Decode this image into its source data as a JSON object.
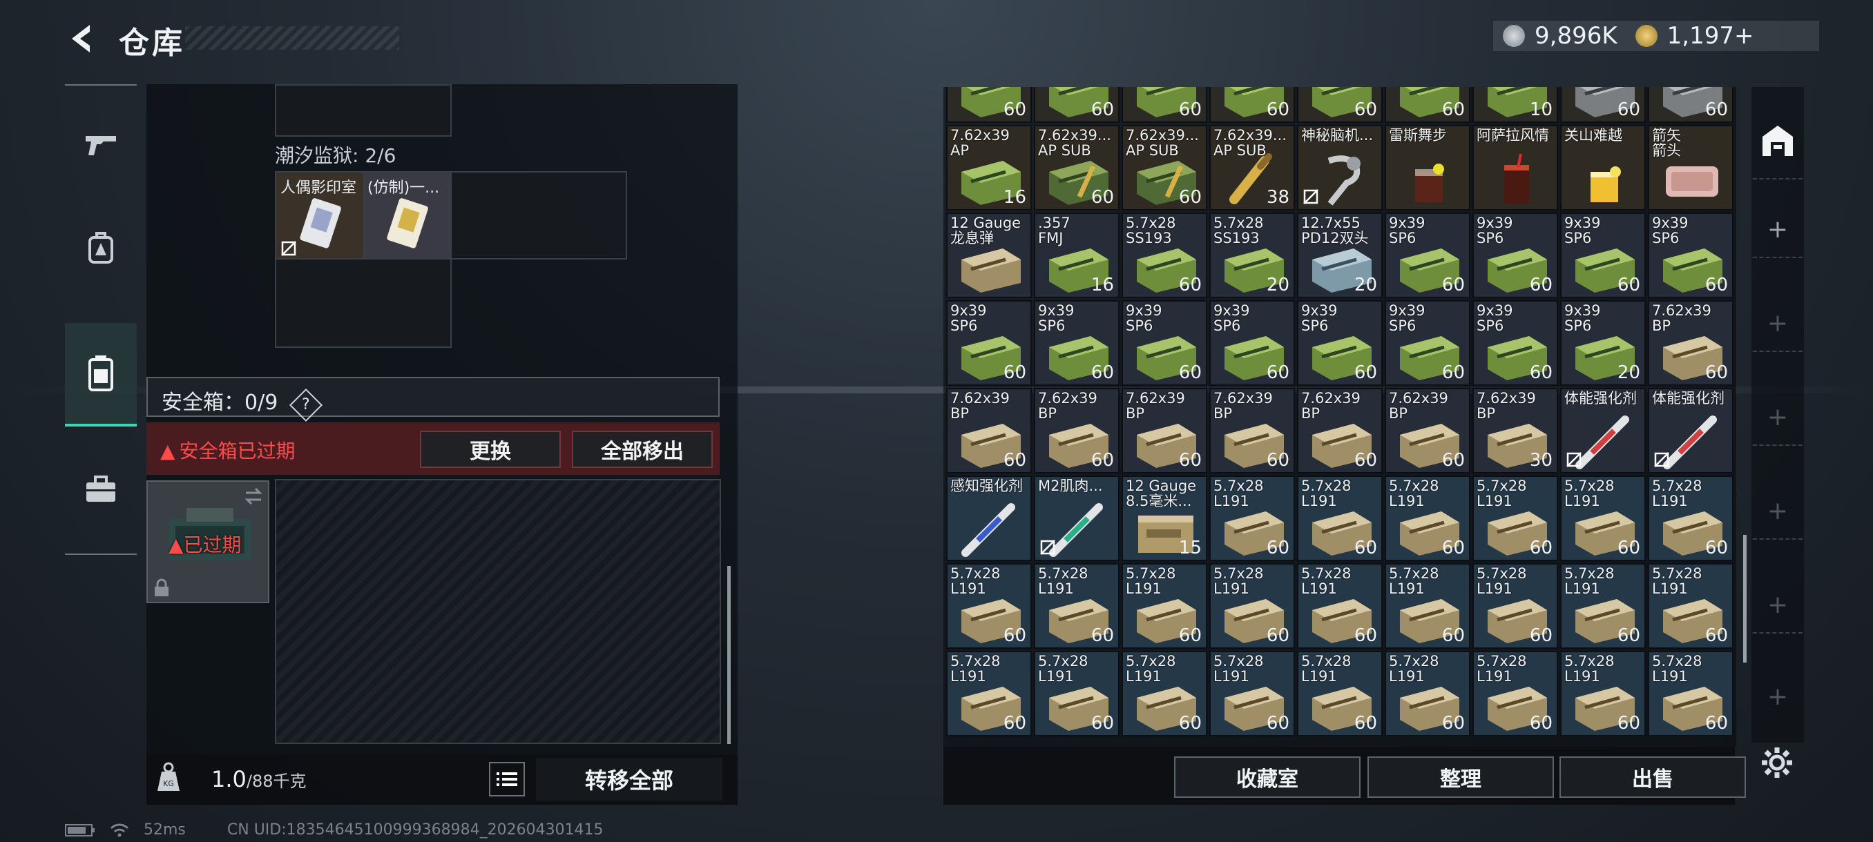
{
  "header": {
    "title": "仓库",
    "currency": [
      {
        "icon": "silver-coin-icon",
        "value": "9,896K"
      },
      {
        "icon": "gold-coin-icon",
        "value": "1,197+"
      }
    ]
  },
  "nav": [
    {
      "icon": "gun-icon"
    },
    {
      "icon": "backpack-icon"
    },
    {
      "icon": "safe-container-icon",
      "active": true
    },
    {
      "icon": "toolbox-icon"
    }
  ],
  "stash": {
    "prison_label": "潮汐监狱: 2/6",
    "prison_items": [
      "人偶影印室",
      "(仿制)一..."
    ],
    "safebox_label": "安全箱：0/9",
    "safebox_help": "?",
    "expired_warning": "安全箱已过期",
    "replace_button": "更换",
    "remove_all_button": "全部移出",
    "slot_expired": "已过期",
    "weight_value": "1.0",
    "weight_unit": "/88千克",
    "transfer_all_button": "转移全部"
  },
  "grid_rows": [
    [
      {
        "n": "",
        "c": "60",
        "k": "green"
      },
      {
        "n": "",
        "c": "60",
        "k": "green"
      },
      {
        "n": "",
        "c": "60",
        "k": "green"
      },
      {
        "n": "",
        "c": "60",
        "k": "green"
      },
      {
        "n": "",
        "c": "60",
        "k": "green"
      },
      {
        "n": "",
        "c": "60",
        "k": "green"
      },
      {
        "n": "",
        "c": "10",
        "k": "green"
      },
      {
        "n": "",
        "c": "60",
        "k": "gray"
      },
      {
        "n": "",
        "c": "60",
        "k": "gray"
      }
    ],
    [
      {
        "n": "7.62x39\nAP",
        "c": "16",
        "k": "green"
      },
      {
        "n": "7.62x39...\nAP SUB",
        "c": "60",
        "k": "greenb"
      },
      {
        "n": "7.62x39...\nAP SUB",
        "c": "60",
        "k": "greenb"
      },
      {
        "n": "7.62x39...\nAP SUB",
        "c": "38",
        "k": "bullet"
      },
      {
        "n": "神秘脑机...",
        "c": "",
        "k": "brain",
        "ns": true
      },
      {
        "n": "雷斯舞步",
        "c": "",
        "k": "drink1"
      },
      {
        "n": "阿萨拉风情",
        "c": "",
        "k": "drink2"
      },
      {
        "n": "关山难越",
        "c": "",
        "k": "drink3"
      },
      {
        "n": "箭矢\n箭头",
        "c": "",
        "k": "pink"
      }
    ],
    [
      {
        "n": "12 Gauge\n龙息弹",
        "c": "",
        "k": "tan"
      },
      {
        "n": ".357\nFMJ",
        "c": "16",
        "k": "green"
      },
      {
        "n": "5.7x28\nSS193",
        "c": "60",
        "k": "green"
      },
      {
        "n": "5.7x28\nSS193",
        "c": "20",
        "k": "green"
      },
      {
        "n": "12.7x55\nPD12双头",
        "c": "20",
        "k": "blue"
      },
      {
        "n": "9x39\nSP6",
        "c": "60",
        "k": "green"
      },
      {
        "n": "9x39\nSP6",
        "c": "60",
        "k": "green"
      },
      {
        "n": "9x39\nSP6",
        "c": "60",
        "k": "green"
      },
      {
        "n": "9x39\nSP6",
        "c": "60",
        "k": "green"
      }
    ],
    [
      {
        "n": "9x39\nSP6",
        "c": "60",
        "k": "green"
      },
      {
        "n": "9x39\nSP6",
        "c": "60",
        "k": "green"
      },
      {
        "n": "9x39\nSP6",
        "c": "60",
        "k": "green"
      },
      {
        "n": "9x39\nSP6",
        "c": "60",
        "k": "green"
      },
      {
        "n": "9x39\nSP6",
        "c": "60",
        "k": "green"
      },
      {
        "n": "9x39\nSP6",
        "c": "60",
        "k": "green"
      },
      {
        "n": "9x39\nSP6",
        "c": "60",
        "k": "green"
      },
      {
        "n": "9x39\nSP6",
        "c": "20",
        "k": "green"
      },
      {
        "n": "7.62x39\nBP",
        "c": "60",
        "k": "tan"
      }
    ],
    [
      {
        "n": "7.62x39\nBP",
        "c": "60",
        "k": "tan"
      },
      {
        "n": "7.62x39\nBP",
        "c": "60",
        "k": "tan"
      },
      {
        "n": "7.62x39\nBP",
        "c": "60",
        "k": "tan"
      },
      {
        "n": "7.62x39\nBP",
        "c": "60",
        "k": "tan"
      },
      {
        "n": "7.62x39\nBP",
        "c": "60",
        "k": "tan"
      },
      {
        "n": "7.62x39\nBP",
        "c": "60",
        "k": "tan"
      },
      {
        "n": "7.62x39\nBP",
        "c": "30",
        "k": "tan"
      },
      {
        "n": "体能强化剂",
        "c": "",
        "k": "syringe_r",
        "ns": true
      },
      {
        "n": "体能强化剂",
        "c": "",
        "k": "syringe_r",
        "ns": true
      }
    ],
    [
      {
        "n": "感知强化剂",
        "c": "",
        "k": "syringe_b"
      },
      {
        "n": "M2肌肉...",
        "c": "",
        "k": "syringe_g",
        "ns": true
      },
      {
        "n": "12 Gauge\n8.5毫米...",
        "c": "15",
        "k": "tanbox"
      },
      {
        "n": "5.7x28\nL191",
        "c": "60",
        "k": "tan"
      },
      {
        "n": "5.7x28\nL191",
        "c": "60",
        "k": "tan"
      },
      {
        "n": "5.7x28\nL191",
        "c": "60",
        "k": "tan"
      },
      {
        "n": "5.7x28\nL191",
        "c": "60",
        "k": "tan"
      },
      {
        "n": "5.7x28\nL191",
        "c": "60",
        "k": "tan"
      },
      {
        "n": "5.7x28\nL191",
        "c": "60",
        "k": "tan"
      }
    ],
    [
      {
        "n": "5.7x28\nL191",
        "c": "60",
        "k": "tan"
      },
      {
        "n": "5.7x28\nL191",
        "c": "60",
        "k": "tan"
      },
      {
        "n": "5.7x28\nL191",
        "c": "60",
        "k": "tan"
      },
      {
        "n": "5.7x28\nL191",
        "c": "60",
        "k": "tan"
      },
      {
        "n": "5.7x28\nL191",
        "c": "60",
        "k": "tan"
      },
      {
        "n": "5.7x28\nL191",
        "c": "60",
        "k": "tan"
      },
      {
        "n": "5.7x28\nL191",
        "c": "60",
        "k": "tan"
      },
      {
        "n": "5.7x28\nL191",
        "c": "60",
        "k": "tan"
      },
      {
        "n": "5.7x28\nL191",
        "c": "60",
        "k": "tan"
      }
    ],
    [
      {
        "n": "5.7x28\nL191",
        "c": "60",
        "k": "tan"
      },
      {
        "n": "5.7x28\nL191",
        "c": "60",
        "k": "tan"
      },
      {
        "n": "5.7x28\nL191",
        "c": "60",
        "k": "tan"
      },
      {
        "n": "5.7x28\nL191",
        "c": "60",
        "k": "tan"
      },
      {
        "n": "5.7x28\nL191",
        "c": "60",
        "k": "tan"
      },
      {
        "n": "5.7x28\nL191",
        "c": "60",
        "k": "tan"
      },
      {
        "n": "5.7x28\nL191",
        "c": "60",
        "k": "tan"
      },
      {
        "n": "5.7x28\nL191",
        "c": "60",
        "k": "tan"
      },
      {
        "n": "5.7x28\nL191",
        "c": "60",
        "k": "tan"
      }
    ]
  ],
  "row_bg": [
    "#2c2a24",
    "#2f2a22",
    "#272d38",
    "#272d38",
    "#272d38",
    "#253848",
    "#253848",
    "#253848"
  ],
  "actions": {
    "collection": "收藏室",
    "organize": "整理",
    "sell": "出售"
  },
  "side_tabs": {
    "icon": "warehouse-icon",
    "plus": "+"
  },
  "status": {
    "ping": "52ms",
    "uid": "CN UID:18354645100999368984_202604301415"
  },
  "colors": {
    "accent": "#3fd6b8",
    "danger": "#ff4a4a",
    "danger_bg": "#4a1c20"
  }
}
